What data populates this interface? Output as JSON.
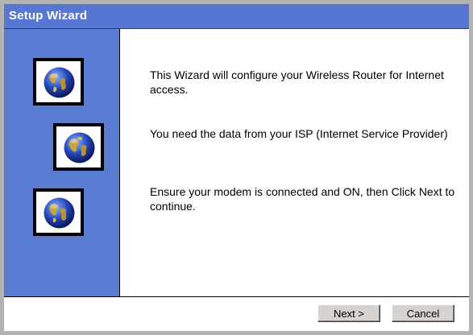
{
  "window": {
    "title": "Setup Wizard"
  },
  "sidebar": {
    "icons": [
      "globe-icon",
      "globe-icon",
      "globe-icon"
    ]
  },
  "content": {
    "paragraphs": [
      "This Wizard will configure your Wireless Router for Internet access.",
      "You need the data from your ISP (Internet Service Provider)",
      "Ensure your modem is connected and ON, then Click Next to continue."
    ]
  },
  "buttons": {
    "next_label": "Next >",
    "cancel_label": "Cancel"
  },
  "colors": {
    "titlebar": "#5777d2",
    "sidebar": "#5a7bd4",
    "button_face": "#d6d3ce"
  }
}
